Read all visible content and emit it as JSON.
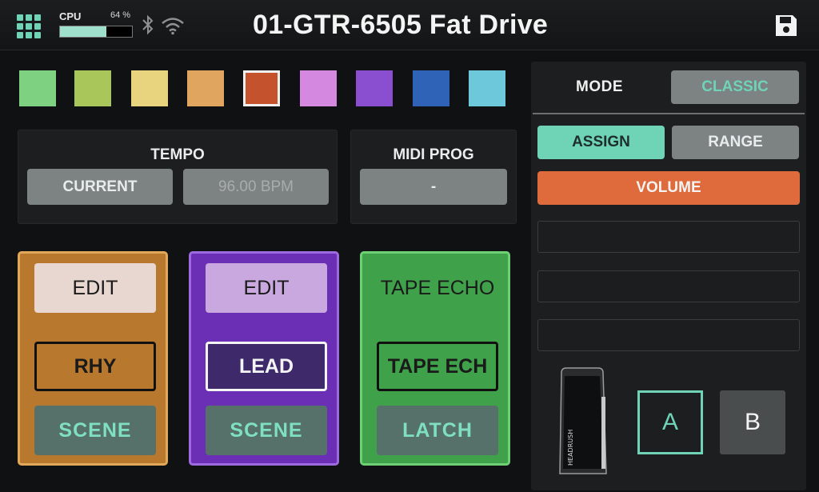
{
  "topbar": {
    "cpu_label": "CPU",
    "cpu_percent_text": "64 %",
    "cpu_percent_value": 64,
    "preset_title": "01-GTR-6505 Fat Drive",
    "icons": [
      "grid-menu-icon",
      "bluetooth-icon",
      "wifi-icon",
      "save-icon"
    ]
  },
  "swatches": [
    {
      "color": "#7fd182",
      "selected": false
    },
    {
      "color": "#a8c65a",
      "selected": false
    },
    {
      "color": "#e8d37f",
      "selected": false
    },
    {
      "color": "#e0a55e",
      "selected": false
    },
    {
      "color": "#c4532d",
      "selected": true
    },
    {
      "color": "#d488df",
      "selected": false
    },
    {
      "color": "#8a4fd0",
      "selected": false
    },
    {
      "color": "#2e63b8",
      "selected": false
    },
    {
      "color": "#6ec8dc",
      "selected": false
    }
  ],
  "tempo": {
    "title": "TEMPO",
    "current_label": "CURRENT",
    "bpm_value": "96.00 BPM"
  },
  "midi_prog": {
    "title": "MIDI PROG",
    "value": "-"
  },
  "footswitches": [
    {
      "color": "#b8782e",
      "edit_label": "EDIT",
      "name": "RHY",
      "scene_label": "SCENE"
    },
    {
      "color": "#7232b8",
      "edit_label": "EDIT",
      "name": "LEAD",
      "scene_label": "SCENE"
    },
    {
      "color": "#3fa24a",
      "top_label": "TAPE ECHO",
      "name": "TAPE ECH",
      "latch_label": "LATCH"
    }
  ],
  "right_panel": {
    "mode_label": "MODE",
    "mode_value": "CLASSIC",
    "assign_label": "ASSIGN",
    "range_label": "RANGE",
    "volume_label": "VOLUME",
    "pedal_brand": "HEADRUSH",
    "a_label": "A",
    "b_label": "B"
  },
  "colors": {
    "accent_teal": "#6fd4b6",
    "volume_orange": "#df6a3c",
    "button_gray": "#7d8283"
  }
}
